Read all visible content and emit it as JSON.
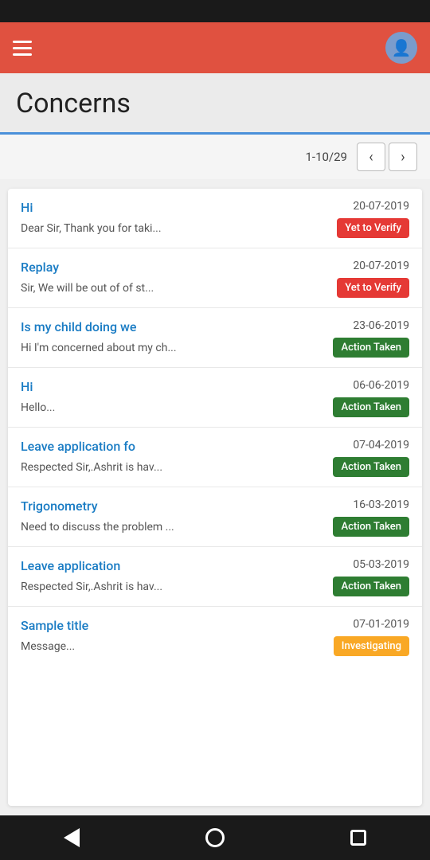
{
  "app_bar": {
    "title": "Concerns"
  },
  "page_header": {
    "title": "Concerns"
  },
  "pagination": {
    "info": "1-10/29",
    "prev_label": "<",
    "next_label": ">"
  },
  "badges": {
    "yet_to_verify": "Yet to Verify",
    "action_taken": "Action Taken",
    "investigating": "Investigating"
  },
  "concerns": [
    {
      "title": "Hi",
      "date": "20-07-2019",
      "preview": "Dear Sir, Thank you for taki...",
      "badge": "yet_to_verify"
    },
    {
      "title": "Replay",
      "date": "20-07-2019",
      "preview": "Sir, We will be out of of st...",
      "badge": "yet_to_verify"
    },
    {
      "title": "Is my child doing we",
      "date": "23-06-2019",
      "preview": "Hi I'm concerned about my ch...",
      "badge": "action_taken"
    },
    {
      "title": "Hi",
      "date": "06-06-2019",
      "preview": "Hello...",
      "badge": "action_taken"
    },
    {
      "title": "Leave application fo",
      "date": "07-04-2019",
      "preview": "Respected Sir,.Ashrit is hav...",
      "badge": "action_taken"
    },
    {
      "title": "Trigonometry",
      "date": "16-03-2019",
      "preview": "Need to discuss the problem ...",
      "badge": "action_taken"
    },
    {
      "title": "Leave application",
      "date": "05-03-2019",
      "preview": "Respected Sir,.Ashrit is hav...",
      "badge": "action_taken"
    },
    {
      "title": "Sample title",
      "date": "07-01-2019",
      "preview": "Message...",
      "badge": "investigating"
    }
  ]
}
